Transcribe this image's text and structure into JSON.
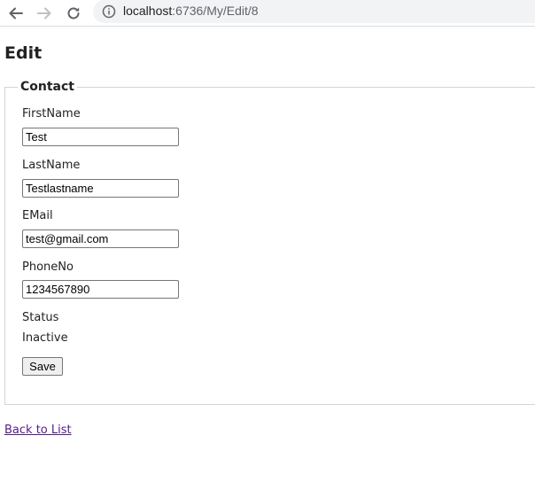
{
  "browser": {
    "url_host": "localhost",
    "url_path": ":6736/My/Edit/8"
  },
  "page": {
    "title": "Edit"
  },
  "form": {
    "legend": "Contact",
    "fields": [
      {
        "label": "FirstName",
        "value": "Test"
      },
      {
        "label": "LastName",
        "value": "Testlastname"
      },
      {
        "label": "EMail",
        "value": "test@gmail.com"
      },
      {
        "label": "PhoneNo",
        "value": "1234567890"
      }
    ],
    "status": {
      "label": "Status",
      "value": "Inactive"
    },
    "save_label": "Save"
  },
  "back_link": "Back to List"
}
